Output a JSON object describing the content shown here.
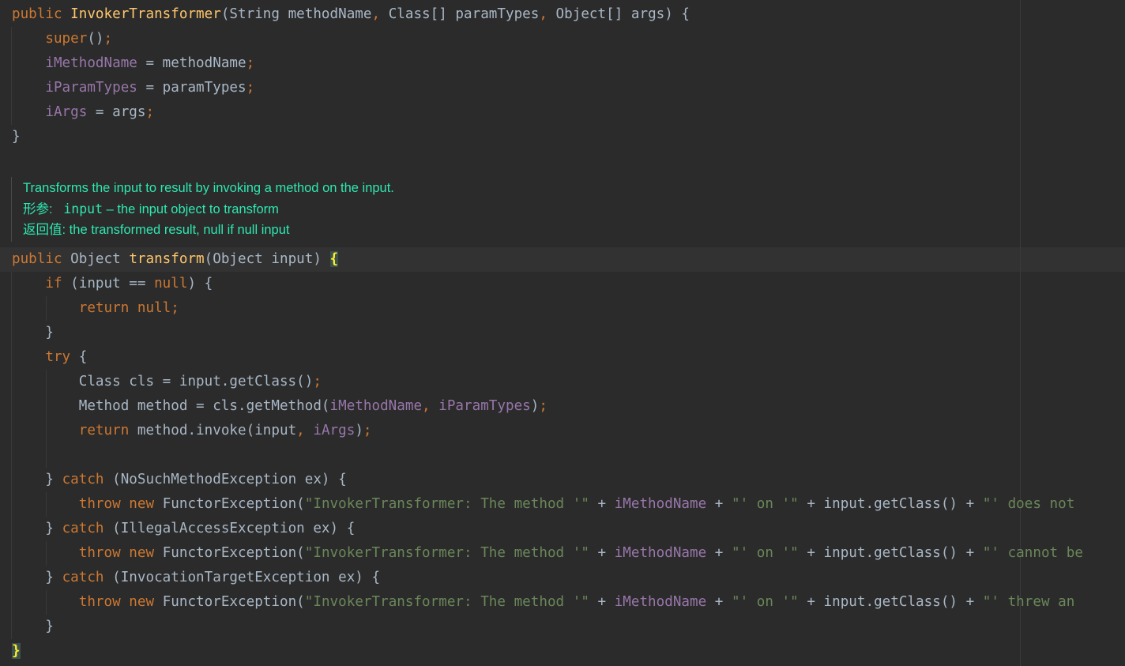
{
  "theme": {
    "background": "#2b2b2b",
    "text": "#a9b7c6",
    "keyword": "#cc7832",
    "method_decl": "#ffc66d",
    "field": "#9876aa",
    "string": "#6a8759",
    "doc_text": "#2ee8b0",
    "brace_match_fg": "#ffef28"
  },
  "code": {
    "lines": [
      {
        "tokens": [
          {
            "t": "public ",
            "c": "kw"
          },
          {
            "t": "InvokerTransformer",
            "c": "fn"
          },
          {
            "t": "(String methodName",
            "c": "plain"
          },
          {
            "t": ", ",
            "c": "kw"
          },
          {
            "t": "Class[] paramTypes",
            "c": "plain"
          },
          {
            "t": ", ",
            "c": "kw"
          },
          {
            "t": "Object[] args) {",
            "c": "plain"
          }
        ]
      },
      {
        "tokens": [
          {
            "t": "    ",
            "c": "plain"
          },
          {
            "t": "super",
            "c": "kw"
          },
          {
            "t": "()",
            "c": "plain"
          },
          {
            "t": ";",
            "c": "kw"
          }
        ]
      },
      {
        "tokens": [
          {
            "t": "    ",
            "c": "plain"
          },
          {
            "t": "iMethodName",
            "c": "fld"
          },
          {
            "t": " = methodName",
            "c": "plain"
          },
          {
            "t": ";",
            "c": "kw"
          }
        ]
      },
      {
        "tokens": [
          {
            "t": "    ",
            "c": "plain"
          },
          {
            "t": "iParamTypes",
            "c": "fld"
          },
          {
            "t": " = paramTypes",
            "c": "plain"
          },
          {
            "t": ";",
            "c": "kw"
          }
        ]
      },
      {
        "tokens": [
          {
            "t": "    ",
            "c": "plain"
          },
          {
            "t": "iArgs",
            "c": "fld"
          },
          {
            "t": " = args",
            "c": "plain"
          },
          {
            "t": ";",
            "c": "kw"
          }
        ]
      },
      {
        "tokens": [
          {
            "t": "}",
            "c": "plain"
          }
        ]
      },
      {
        "tokens": [
          {
            "t": "public ",
            "c": "kw"
          },
          {
            "t": "Object ",
            "c": "plain"
          },
          {
            "t": "transform",
            "c": "fn"
          },
          {
            "t": "(Object input) ",
            "c": "plain"
          },
          {
            "t": "{",
            "c": "brace-match"
          }
        ]
      },
      {
        "tokens": [
          {
            "t": "    ",
            "c": "plain"
          },
          {
            "t": "if ",
            "c": "kw"
          },
          {
            "t": "(input == ",
            "c": "plain"
          },
          {
            "t": "null",
            "c": "kw"
          },
          {
            "t": ") {",
            "c": "plain"
          }
        ]
      },
      {
        "tokens": [
          {
            "t": "        ",
            "c": "plain"
          },
          {
            "t": "return null;",
            "c": "kw"
          }
        ]
      },
      {
        "tokens": [
          {
            "t": "    }",
            "c": "plain"
          }
        ]
      },
      {
        "tokens": [
          {
            "t": "    ",
            "c": "plain"
          },
          {
            "t": "try ",
            "c": "kw"
          },
          {
            "t": "{",
            "c": "plain"
          }
        ]
      },
      {
        "tokens": [
          {
            "t": "        Class cls = input.getClass()",
            "c": "plain"
          },
          {
            "t": ";",
            "c": "kw"
          }
        ]
      },
      {
        "tokens": [
          {
            "t": "        Method method = cls.getMethod(",
            "c": "plain"
          },
          {
            "t": "iMethodName",
            "c": "fld"
          },
          {
            "t": ", ",
            "c": "kw"
          },
          {
            "t": "iParamTypes",
            "c": "fld"
          },
          {
            "t": ")",
            "c": "plain"
          },
          {
            "t": ";",
            "c": "kw"
          }
        ]
      },
      {
        "tokens": [
          {
            "t": "        ",
            "c": "plain"
          },
          {
            "t": "return ",
            "c": "kw"
          },
          {
            "t": "method.invoke(input",
            "c": "plain"
          },
          {
            "t": ", ",
            "c": "kw"
          },
          {
            "t": "iArgs",
            "c": "fld"
          },
          {
            "t": ")",
            "c": "plain"
          },
          {
            "t": ";",
            "c": "kw"
          }
        ]
      },
      {
        "tokens": [
          {
            "t": "",
            "c": "plain"
          }
        ]
      },
      {
        "tokens": [
          {
            "t": "    } ",
            "c": "plain"
          },
          {
            "t": "catch ",
            "c": "kw"
          },
          {
            "t": "(NoSuchMethodException ex) {",
            "c": "plain"
          }
        ]
      },
      {
        "tokens": [
          {
            "t": "        ",
            "c": "plain"
          },
          {
            "t": "throw new ",
            "c": "kw"
          },
          {
            "t": "FunctorException(",
            "c": "plain"
          },
          {
            "t": "\"InvokerTransformer: The method '\"",
            "c": "str"
          },
          {
            "t": " + ",
            "c": "plain"
          },
          {
            "t": "iMethodName",
            "c": "fld"
          },
          {
            "t": " + ",
            "c": "plain"
          },
          {
            "t": "\"' on '\"",
            "c": "str"
          },
          {
            "t": " + input.getClass() + ",
            "c": "plain"
          },
          {
            "t": "\"' does not",
            "c": "str"
          }
        ]
      },
      {
        "tokens": [
          {
            "t": "    } ",
            "c": "plain"
          },
          {
            "t": "catch ",
            "c": "kw"
          },
          {
            "t": "(IllegalAccessException ex) {",
            "c": "plain"
          }
        ]
      },
      {
        "tokens": [
          {
            "t": "        ",
            "c": "plain"
          },
          {
            "t": "throw new ",
            "c": "kw"
          },
          {
            "t": "FunctorException(",
            "c": "plain"
          },
          {
            "t": "\"InvokerTransformer: The method '\"",
            "c": "str"
          },
          {
            "t": " + ",
            "c": "plain"
          },
          {
            "t": "iMethodName",
            "c": "fld"
          },
          {
            "t": " + ",
            "c": "plain"
          },
          {
            "t": "\"' on '\"",
            "c": "str"
          },
          {
            "t": " + input.getClass() + ",
            "c": "plain"
          },
          {
            "t": "\"' cannot be",
            "c": "str"
          }
        ]
      },
      {
        "tokens": [
          {
            "t": "    } ",
            "c": "plain"
          },
          {
            "t": "catch ",
            "c": "kw"
          },
          {
            "t": "(InvocationTargetException ex) {",
            "c": "plain"
          }
        ]
      },
      {
        "tokens": [
          {
            "t": "        ",
            "c": "plain"
          },
          {
            "t": "throw new ",
            "c": "kw"
          },
          {
            "t": "FunctorException(",
            "c": "plain"
          },
          {
            "t": "\"InvokerTransformer: The method '\"",
            "c": "str"
          },
          {
            "t": " + ",
            "c": "plain"
          },
          {
            "t": "iMethodName",
            "c": "fld"
          },
          {
            "t": " + ",
            "c": "plain"
          },
          {
            "t": "\"' on '\"",
            "c": "str"
          },
          {
            "t": " + input.getClass() + ",
            "c": "plain"
          },
          {
            "t": "\"' threw an",
            "c": "str"
          }
        ]
      },
      {
        "tokens": [
          {
            "t": "    }",
            "c": "plain"
          }
        ]
      },
      {
        "tokens": [
          {
            "t": "}",
            "c": "brace-match"
          }
        ]
      }
    ]
  },
  "javadoc": {
    "summary": "Transforms the input to result by invoking a method on the input.",
    "params_label": "形参:",
    "param_name": "input",
    "param_desc": " – the input object to transform",
    "returns_label": "返回值:",
    "returns_desc": " the transformed result, null if null input"
  }
}
